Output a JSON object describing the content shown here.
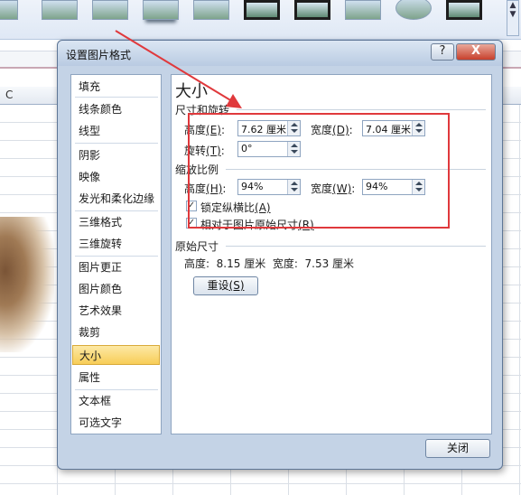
{
  "dialog": {
    "title": "设置图片格式",
    "help_glyph": "?",
    "close_glyph": "X",
    "close_button_label": "关闭"
  },
  "nav": {
    "items": [
      {
        "label": "填充",
        "selected": false
      },
      {
        "label": "线条颜色",
        "selected": false
      },
      {
        "label": "线型",
        "selected": false
      },
      {
        "label": "阴影",
        "selected": false
      },
      {
        "label": "映像",
        "selected": false
      },
      {
        "label": "发光和柔化边缘",
        "selected": false
      },
      {
        "label": "三维格式",
        "selected": false
      },
      {
        "label": "三维旋转",
        "selected": false
      },
      {
        "label": "图片更正",
        "selected": false
      },
      {
        "label": "图片颜色",
        "selected": false
      },
      {
        "label": "艺术效果",
        "selected": false
      },
      {
        "label": "裁剪",
        "selected": false
      },
      {
        "label": "大小",
        "selected": true
      },
      {
        "label": "属性",
        "selected": false
      },
      {
        "label": "文本框",
        "selected": false
      },
      {
        "label": "可选文字",
        "selected": false
      }
    ]
  },
  "panel": {
    "title": "大小",
    "size_rotate": {
      "group_title": "尺寸和旋转",
      "height_label": "高度",
      "height_key": "(E)",
      "height_value": "7.62 厘米",
      "width_label": "宽度",
      "width_key": "(D)",
      "width_value": "7.04 厘米",
      "rotate_label": "旋转",
      "rotate_key": "(T)",
      "rotate_value": "0°"
    },
    "scale": {
      "group_title": "缩放比例",
      "height_label": "高度",
      "height_key": "(H)",
      "height_value": "94%",
      "width_label": "宽度",
      "width_key": "(W)",
      "width_value": "94%",
      "lock_aspect_label": "锁定纵横比",
      "lock_aspect_key": "(A)",
      "lock_aspect_checked": true,
      "relative_label": "相对于图片原始尺寸",
      "relative_key": "(R)",
      "relative_checked": true
    },
    "original": {
      "group_title": "原始尺寸",
      "text": "高度:  8.15 厘米  宽度:  7.53 厘米",
      "reset_label": "重设",
      "reset_key": "(S)"
    }
  },
  "sheet": {
    "column_label": "C"
  },
  "colors": {
    "selection_red": "#e0393c",
    "selected_nav": "#f7cd57",
    "dialog_frame": "#c4d3e6"
  }
}
